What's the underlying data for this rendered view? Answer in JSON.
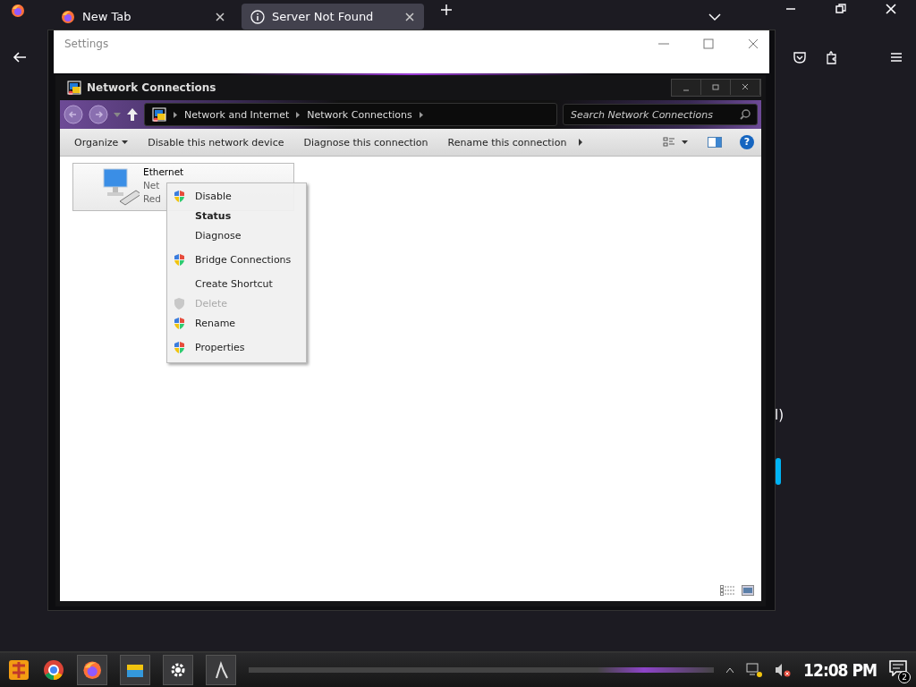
{
  "browser": {
    "tabs": [
      {
        "label": "New Tab",
        "selected": false
      },
      {
        "label": "Server Not Found",
        "selected": true
      }
    ],
    "page_fragment": "l)"
  },
  "settings_window": {
    "title": "Settings"
  },
  "explorer": {
    "title": "Network Connections",
    "breadcrumb": [
      "Network and Internet",
      "Network Connections"
    ],
    "search": {
      "placeholder": "Search Network Connections"
    },
    "toolbar": [
      {
        "label": "Organize",
        "dropdown": true
      },
      {
        "label": "Disable this network device",
        "dropdown": false
      },
      {
        "label": "Diagnose this connection",
        "dropdown": false
      },
      {
        "label": "Rename this connection",
        "dropdown": false
      }
    ],
    "help": "?",
    "connection": {
      "name": "Ethernet",
      "line_1": "Net",
      "line_2": "Red"
    }
  },
  "context_menu": [
    {
      "label": "Disable",
      "kind": "item",
      "icon": true,
      "default": false,
      "disabled": false
    },
    {
      "label": "Status",
      "kind": "item",
      "icon": false,
      "default": true,
      "disabled": false
    },
    {
      "label": "Diagnose",
      "kind": "item",
      "icon": false,
      "default": false,
      "disabled": false
    },
    {
      "kind": "separator"
    },
    {
      "label": "Bridge Connections",
      "kind": "item",
      "icon": true,
      "default": false,
      "disabled": false
    },
    {
      "kind": "separator"
    },
    {
      "label": "Create Shortcut",
      "kind": "item",
      "icon": false,
      "default": false,
      "disabled": false
    },
    {
      "label": "Delete",
      "kind": "item",
      "icon": true,
      "default": false,
      "disabled": true
    },
    {
      "label": "Rename",
      "kind": "item",
      "icon": true,
      "default": false,
      "disabled": false
    },
    {
      "kind": "separator"
    },
    {
      "label": "Properties",
      "kind": "item",
      "icon": true,
      "default": false,
      "disabled": false
    }
  ],
  "taskbar": {
    "clock": "12:08 PM",
    "notifications": "2"
  }
}
